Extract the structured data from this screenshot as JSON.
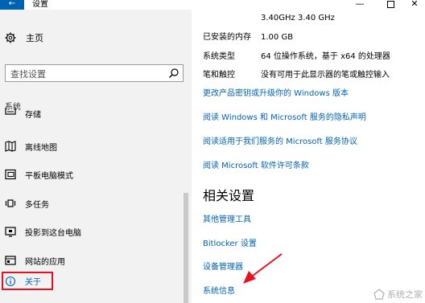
{
  "window": {
    "back_glyph": "←",
    "title": "设置",
    "minimize_glyph": "—",
    "close_glyph": "✕"
  },
  "sidebar": {
    "home_label": "主页",
    "search_placeholder": "查找设置",
    "section_label": "系统",
    "items": [
      {
        "label": "存储",
        "icon": "storage-icon"
      },
      {
        "label": "离线地图",
        "icon": "map-icon"
      },
      {
        "label": "平板电脑模式",
        "icon": "tablet-icon"
      },
      {
        "label": "多任务",
        "icon": "multitask-icon"
      },
      {
        "label": "投影到这台电脑",
        "icon": "project-icon"
      },
      {
        "label": "网站的应用",
        "icon": "apps-for-websites-icon"
      },
      {
        "label": "关于",
        "icon": "info-icon",
        "selected": true
      }
    ]
  },
  "main": {
    "processor_value": "3.40GHz   3.40 GHz",
    "specs": [
      {
        "key": "已安装的内存",
        "value": "1.00 GB"
      },
      {
        "key": "系统类型",
        "value": "64 位操作系统，基于 x64 的处理器"
      },
      {
        "key": "笔和触控",
        "value": "没有可用于此显示器的笔或触控输入"
      }
    ],
    "links": [
      "更改产品密钥或升级你的 Windows 版本",
      "阅读 Windows 和 Microsoft 服务的隐私声明",
      "阅读适用于我们服务的 Microsoft 服务协议",
      "阅读 Microsoft 软件许可条款"
    ],
    "related_title": "相关设置",
    "related_links": [
      "其他管理工具",
      "Bitlocker 设置",
      "设备管理器",
      "系统信息"
    ]
  },
  "colors": {
    "accent": "#0063b1",
    "highlight": "#e81123",
    "sidebar_bg": "#f2f2f2"
  },
  "watermark": {
    "text": "系统之家"
  }
}
